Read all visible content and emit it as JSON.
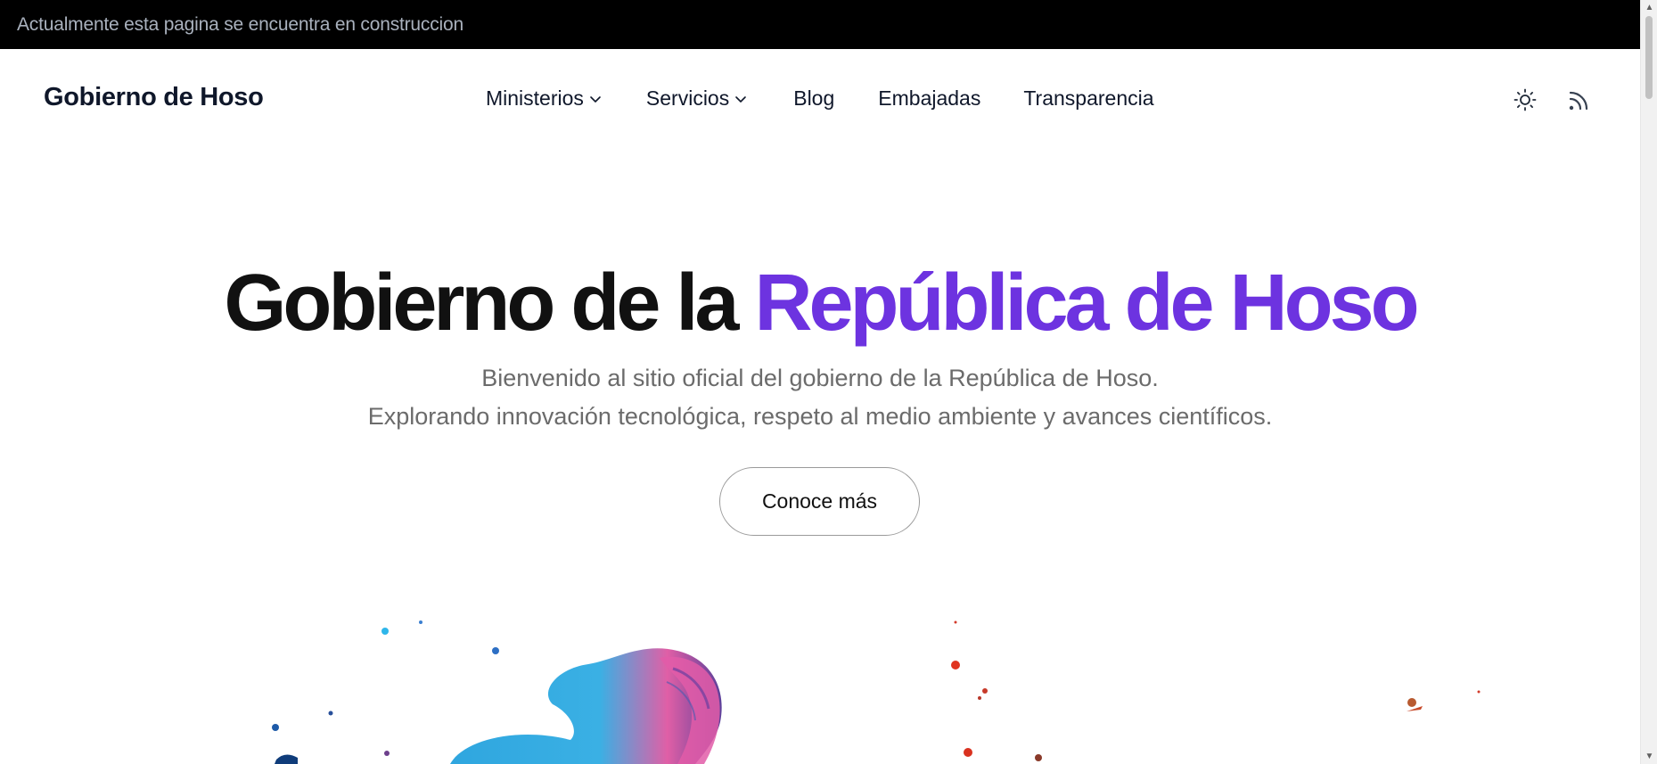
{
  "announcement": "Actualmente esta pagina se encuentra en construccion",
  "header": {
    "brand": "Gobierno de Hoso",
    "nav": [
      {
        "label": "Ministerios",
        "has_dropdown": true
      },
      {
        "label": "Servicios",
        "has_dropdown": true
      },
      {
        "label": "Blog",
        "has_dropdown": false
      },
      {
        "label": "Embajadas",
        "has_dropdown": false
      },
      {
        "label": "Transparencia",
        "has_dropdown": false
      }
    ],
    "icons": [
      "sun-icon",
      "rss-icon"
    ]
  },
  "hero": {
    "title_plain": "Gobierno de la",
    "title_accent": "República de Hoso",
    "subtitle_line1": "Bienvenido al sitio oficial del gobierno de la República de Hoso.",
    "subtitle_line2": "Explorando innovación tecnológica, respeto al medio ambiente y avances científicos.",
    "cta_label": "Conoce más"
  },
  "colors": {
    "accent": "#6d33e0",
    "topbar_bg": "#000000",
    "topbar_text": "#a9b1bd",
    "text": "#111111",
    "muted": "#6b6b6b"
  }
}
